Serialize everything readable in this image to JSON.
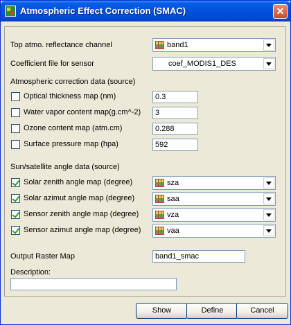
{
  "window": {
    "title": "Atmospheric Effect Correction (SMAC)"
  },
  "form": {
    "toa_label": "Top atmo. reflectance channel",
    "toa_value": "band1",
    "coef_label": "Coefficient file for sensor",
    "coef_value": "coef_MODIS1_DES",
    "atm_section": "Atmospheric correction data (source)",
    "atm_rows": [
      {
        "label": "Optical thickness map (nm)",
        "value": "0.3"
      },
      {
        "label": "Water vapor content map(g.cm^-2)",
        "value": "3"
      },
      {
        "label": "Ozone content map (atm.cm)",
        "value": "0.288"
      },
      {
        "label": "Surface pressure map (hpa)",
        "value": "592"
      }
    ],
    "angle_section": "Sun/satellite angle data (source)",
    "angle_rows": [
      {
        "label": "Solar zenith angle map (degree)",
        "value": "sza"
      },
      {
        "label": "Solar azimut angle map (degree)",
        "value": "saa"
      },
      {
        "label": "Sensor zenith angle map (degree)",
        "value": "vza"
      },
      {
        "label": "Sensor azimut angle map (degree)",
        "value": "vaa"
      }
    ],
    "output_label": "Output Raster Map",
    "output_value": "band1_smac",
    "description_label": "Description:",
    "description_value": ""
  },
  "buttons": {
    "show": "Show",
    "define": "Define",
    "cancel": "Cancel"
  }
}
